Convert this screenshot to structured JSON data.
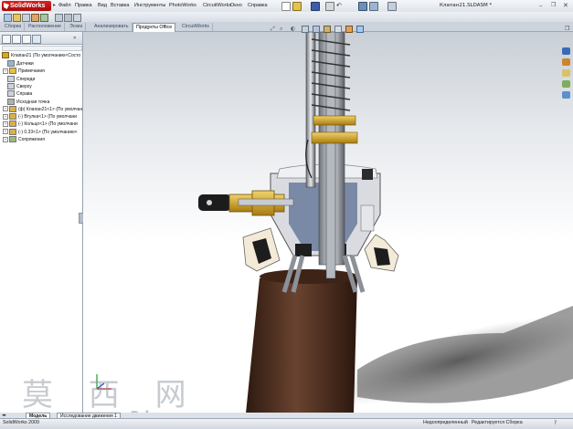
{
  "app": {
    "name": "SolidWorks",
    "document_title": "Клапан21.SLDASM *"
  },
  "menu": [
    "Файл",
    "Правка",
    "Вид",
    "Вставка",
    "Инструменты",
    "PhotoWorks",
    "CircuitWorks",
    "Окно",
    "Справка"
  ],
  "command_tabs": [
    {
      "label": "Сборка",
      "active": false
    },
    {
      "label": "Расположение",
      "active": false
    },
    {
      "label": "Эскиз",
      "active": false
    },
    {
      "label": "Анализировать",
      "active": false
    },
    {
      "label": "Продукты Office",
      "active": true
    },
    {
      "label": "CircuitWorks",
      "active": false
    }
  ],
  "tree": {
    "root": "Клапан21 (По умолчанию<Состо",
    "items": [
      {
        "label": "Датчики",
        "expandable": false,
        "icon": "sensor-icon"
      },
      {
        "label": "Примечания",
        "expandable": true,
        "icon": "annotations-icon"
      },
      {
        "label": "Спереди",
        "expandable": false,
        "icon": "plane-icon"
      },
      {
        "label": "Сверху",
        "expandable": false,
        "icon": "plane-icon"
      },
      {
        "label": "Справа",
        "expandable": false,
        "icon": "plane-icon"
      },
      {
        "label": "Исходная точка",
        "expandable": false,
        "icon": "origin-icon"
      },
      {
        "label": "(ф) Клапан21<1> (По умолчан",
        "expandable": true,
        "icon": "part-icon"
      },
      {
        "label": "(-) Втулка<1> (По умолчани",
        "expandable": true,
        "icon": "part-icon"
      },
      {
        "label": "(-) Кольцо<1> (По умолчани",
        "expandable": true,
        "icon": "part-icon"
      },
      {
        "label": "(-) 0.33<1> (По умолчанию<",
        "expandable": true,
        "icon": "part-icon"
      },
      {
        "label": "Сопряжения",
        "expandable": true,
        "icon": "mates-icon"
      }
    ]
  },
  "bottom_tabs": [
    "Модель",
    "Исследование движения 1"
  ],
  "status": {
    "left": "SolidWorks 2009",
    "center": "Недоопределенный",
    "right": "Редактируется Сборка"
  },
  "watermark": {
    "main": "莫 西 网",
    "sub": "www.3dmax.com"
  },
  "colors": {
    "accent_red": "#c8151b",
    "tab_bar": "#ccd3dd",
    "bottle": "#4a2c1e",
    "brass": "#d6a91a"
  }
}
